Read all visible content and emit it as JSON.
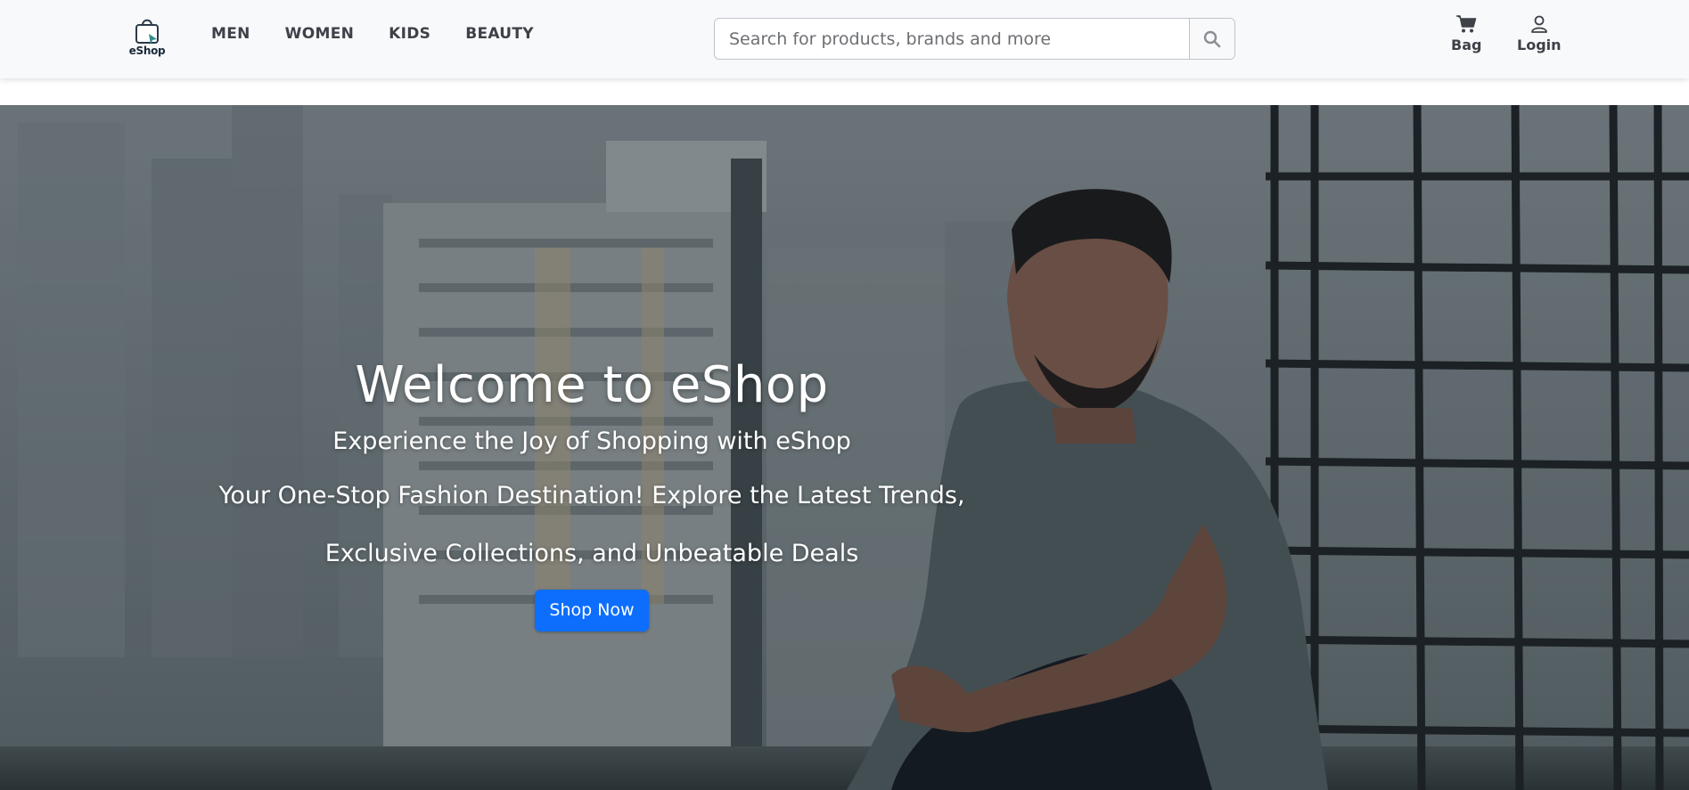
{
  "brand": {
    "name": "eShop",
    "accent": "#2f8c8c"
  },
  "nav": {
    "links": [
      "MEN",
      "WOMEN",
      "KIDS",
      "BEAUTY"
    ]
  },
  "search": {
    "placeholder": "Search for products, brands and more",
    "icon": "search-icon"
  },
  "actions": {
    "bag_label": "Bag",
    "bag_icon": "cart-icon",
    "login_label": "Login",
    "login_icon": "user-icon"
  },
  "hero": {
    "title": "Welcome to eShop",
    "subtitle": "Experience the Joy of Shopping with eShop",
    "line1": "Your One-Stop Fashion Destination! Explore the Latest Trends,",
    "line2": "Exclusive Collections, and Unbeatable Deals",
    "cta_label": "Shop Now",
    "cta_color": "#0d6efd"
  }
}
